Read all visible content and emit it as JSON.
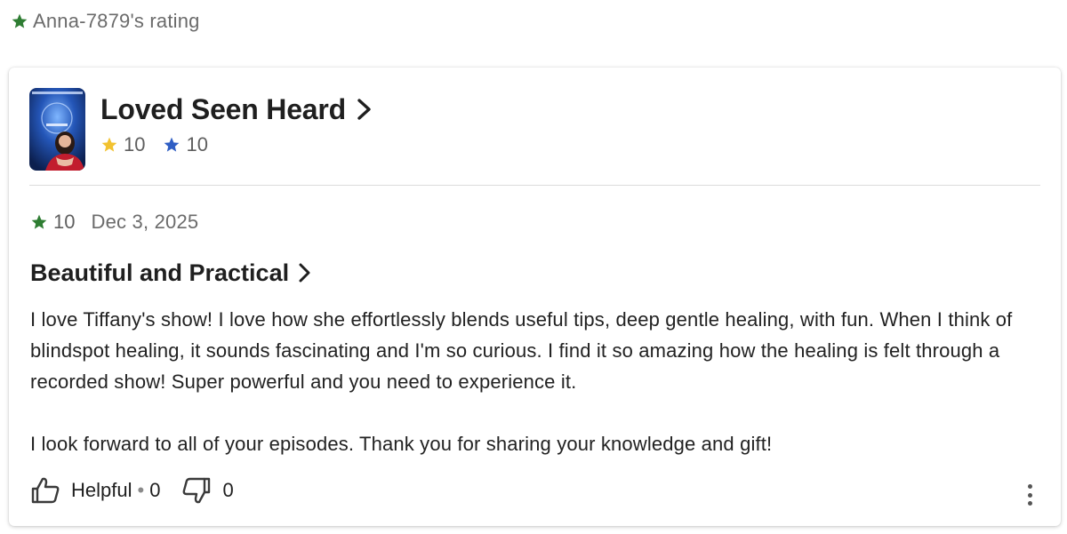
{
  "header": {
    "title": "Anna-7879's rating",
    "star_icon": "star-icon",
    "star_color": "#2e7d32"
  },
  "show": {
    "title": "Loved Seen Heard",
    "cover_icon": "podcast-cover-image",
    "rating_yellow": "10",
    "rating_yellow_color": "#f2c230",
    "rating_blue": "10",
    "rating_blue_color": "#2f5ec4"
  },
  "review": {
    "rating": "10",
    "rating_color": "#2e7d32",
    "date": "Dec 3, 2025",
    "title": "Beautiful and Practical",
    "paragraphs": [
      "I love Tiffany's show! I love how she effortlessly blends useful tips, deep gentle healing, with fun. When I think of blindspot healing, it sounds fascinating and I'm so curious. I find it so amazing how the healing is felt through a recorded show! Super powerful and you need to experience it.",
      "I look forward to all of your episodes. Thank you for sharing your knowledge and gift!"
    ]
  },
  "actions": {
    "helpful_label": "Helpful",
    "separator": "•",
    "helpful_count": "0",
    "dislike_count": "0",
    "more_icon": "more-vertical-icon"
  }
}
